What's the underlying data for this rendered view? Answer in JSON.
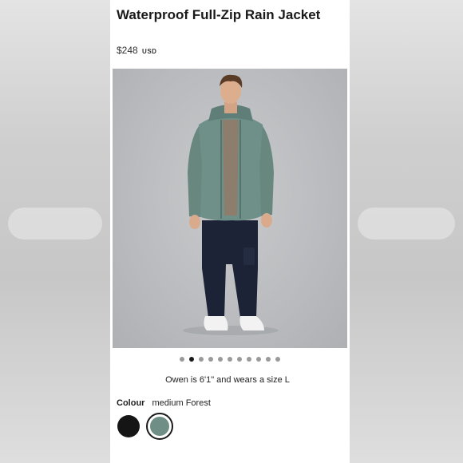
{
  "product": {
    "title": "Waterproof Full-Zip Rain Jacket",
    "price": "$248",
    "currency": "USD"
  },
  "gallery": {
    "total_images": 11,
    "active_index": 1
  },
  "model_note": "Owen is 6'1\" and wears a size L",
  "colour": {
    "label": "Colour",
    "selected_name": "medium Forest",
    "swatches": [
      {
        "name": "black",
        "hex": "#151515",
        "selected": false
      },
      {
        "name": "medium Forest",
        "hex": "#6f8f86",
        "selected": true
      }
    ]
  },
  "colors": {
    "jacket": "#6f9088",
    "pants": "#1c2336",
    "background": "#bcbec1"
  }
}
